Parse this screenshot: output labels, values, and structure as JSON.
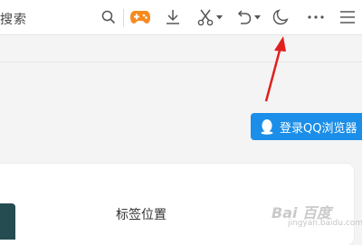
{
  "toolbar": {
    "search_hint": "搜索",
    "icons": [
      "search-icon",
      "game-controller-icon",
      "download-icon",
      "scissors-icon",
      "undo-icon",
      "moon-icon",
      "more-icon",
      "menu-icon"
    ],
    "game_color": "#f58a1f"
  },
  "login": {
    "label": "登录QQ浏览器",
    "color": "#1a8ee8"
  },
  "card": {
    "title": "标签位置"
  },
  "watermark": {
    "brand": "Bai 百度",
    "text": "jingyan.baidu.com"
  },
  "annotation": {
    "arrow_color": "#e0201e"
  }
}
